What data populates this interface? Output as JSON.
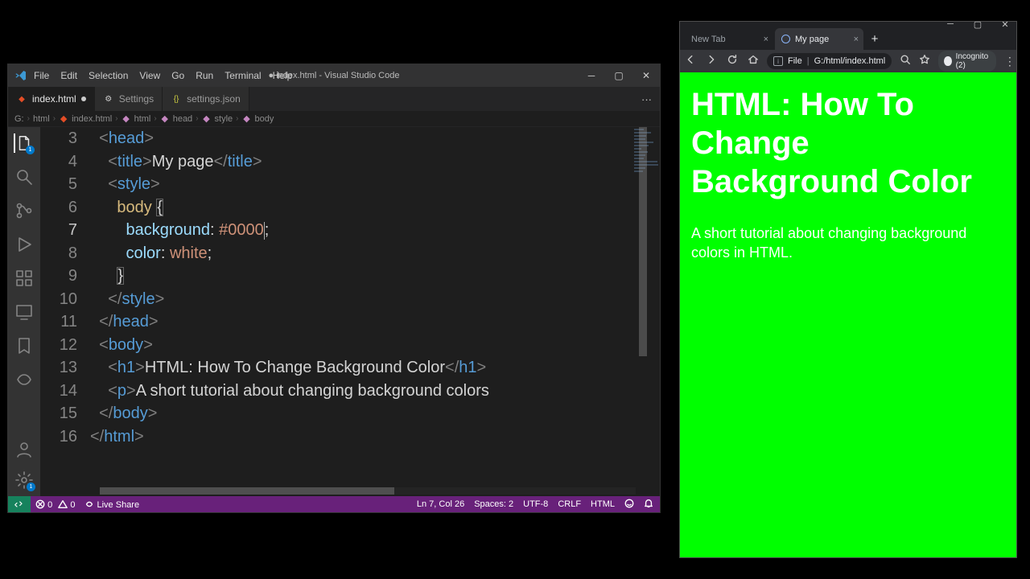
{
  "vscode": {
    "menu": [
      "File",
      "Edit",
      "Selection",
      "View",
      "Go",
      "Run",
      "Terminal",
      "Help"
    ],
    "title_center": "● index.html - Visual Studio Code",
    "tabs": [
      {
        "label": "index.html",
        "icon": "html-file-icon",
        "modified": true,
        "active": true
      },
      {
        "label": "Settings",
        "icon": "gear-icon",
        "modified": false,
        "active": false
      },
      {
        "label": "settings.json",
        "icon": "json-file-icon",
        "modified": false,
        "active": false
      }
    ],
    "breadcrumb": [
      "G:",
      "html",
      "index.html",
      "html",
      "head",
      "style",
      "body"
    ],
    "code_lines": [
      {
        "n": 3,
        "indent": "  ",
        "tokens": [
          {
            "c": "t-pun",
            "t": "<"
          },
          {
            "c": "t-tag",
            "t": "head"
          },
          {
            "c": "t-pun",
            "t": ">"
          }
        ]
      },
      {
        "n": 4,
        "indent": "    ",
        "tokens": [
          {
            "c": "t-pun",
            "t": "<"
          },
          {
            "c": "t-tag",
            "t": "title"
          },
          {
            "c": "t-pun",
            "t": ">"
          },
          {
            "c": "t-text",
            "t": "My page"
          },
          {
            "c": "t-pun",
            "t": "</"
          },
          {
            "c": "t-tag",
            "t": "title"
          },
          {
            "c": "t-pun",
            "t": ">"
          }
        ]
      },
      {
        "n": 5,
        "indent": "    ",
        "tokens": [
          {
            "c": "t-pun",
            "t": "<"
          },
          {
            "c": "t-tag",
            "t": "style"
          },
          {
            "c": "t-pun",
            "t": ">"
          }
        ]
      },
      {
        "n": 6,
        "indent": "      ",
        "tokens": [
          {
            "c": "t-sel",
            "t": "body"
          },
          {
            "c": "t-text",
            "t": " "
          },
          {
            "c": "t-brace",
            "t": "{",
            "box": true
          }
        ]
      },
      {
        "n": 7,
        "indent": "        ",
        "active": true,
        "tokens": [
          {
            "c": "t-prop",
            "t": "background"
          },
          {
            "c": "t-text",
            "t": ": "
          },
          {
            "c": "t-num",
            "t": "#0000"
          },
          {
            "cursor": true
          },
          {
            "c": "t-text",
            "t": ";"
          }
        ]
      },
      {
        "n": 8,
        "indent": "        ",
        "tokens": [
          {
            "c": "t-prop",
            "t": "color"
          },
          {
            "c": "t-text",
            "t": ": "
          },
          {
            "c": "t-val",
            "t": "white"
          },
          {
            "c": "t-text",
            "t": ";"
          }
        ]
      },
      {
        "n": 9,
        "indent": "      ",
        "tokens": [
          {
            "c": "t-brace",
            "t": "}",
            "box": true
          }
        ]
      },
      {
        "n": 10,
        "indent": "    ",
        "tokens": [
          {
            "c": "t-pun",
            "t": "</"
          },
          {
            "c": "t-tag",
            "t": "style"
          },
          {
            "c": "t-pun",
            "t": ">"
          }
        ]
      },
      {
        "n": 11,
        "indent": "  ",
        "tokens": [
          {
            "c": "t-pun",
            "t": "</"
          },
          {
            "c": "t-tag",
            "t": "head"
          },
          {
            "c": "t-pun",
            "t": ">"
          }
        ]
      },
      {
        "n": 12,
        "indent": "  ",
        "tokens": [
          {
            "c": "t-pun",
            "t": "<"
          },
          {
            "c": "t-tag",
            "t": "body"
          },
          {
            "c": "t-pun",
            "t": ">"
          }
        ]
      },
      {
        "n": 13,
        "indent": "    ",
        "tokens": [
          {
            "c": "t-pun",
            "t": "<"
          },
          {
            "c": "t-tag",
            "t": "h1"
          },
          {
            "c": "t-pun",
            "t": ">"
          },
          {
            "c": "t-text",
            "t": "HTML: How To Change Background Color"
          },
          {
            "c": "t-pun",
            "t": "</"
          },
          {
            "c": "t-tag",
            "t": "h1"
          },
          {
            "c": "t-pun",
            "t": ">"
          }
        ]
      },
      {
        "n": 14,
        "indent": "    ",
        "tokens": [
          {
            "c": "t-pun",
            "t": "<"
          },
          {
            "c": "t-tag",
            "t": "p"
          },
          {
            "c": "t-pun",
            "t": ">"
          },
          {
            "c": "t-text",
            "t": "A short tutorial about changing background colors"
          }
        ]
      },
      {
        "n": 15,
        "indent": "  ",
        "tokens": [
          {
            "c": "t-pun",
            "t": "</"
          },
          {
            "c": "t-tag",
            "t": "body"
          },
          {
            "c": "t-pun",
            "t": ">"
          }
        ]
      },
      {
        "n": 16,
        "indent": "",
        "tokens": [
          {
            "c": "t-pun",
            "t": "</"
          },
          {
            "c": "t-tag",
            "t": "html"
          },
          {
            "c": "t-pun",
            "t": ">"
          }
        ]
      }
    ],
    "statusbar": {
      "errors": "0",
      "warnings": "0",
      "live_share": "Live Share",
      "ln_col": "Ln 7, Col 26",
      "spaces": "Spaces: 2",
      "encoding": "UTF-8",
      "eol": "CRLF",
      "lang": "HTML"
    }
  },
  "browser": {
    "tabs": [
      {
        "label": "New Tab",
        "active": false
      },
      {
        "label": "My page",
        "active": true
      }
    ],
    "url_prefix": "File",
    "url_sep": "|",
    "url": "G:/html/index.html",
    "incognito": "Incognito (2)",
    "page": {
      "h1": "HTML: How To Change Background Color",
      "p": "A short tutorial about changing background colors in HTML.",
      "bg": "#00ff00"
    }
  }
}
